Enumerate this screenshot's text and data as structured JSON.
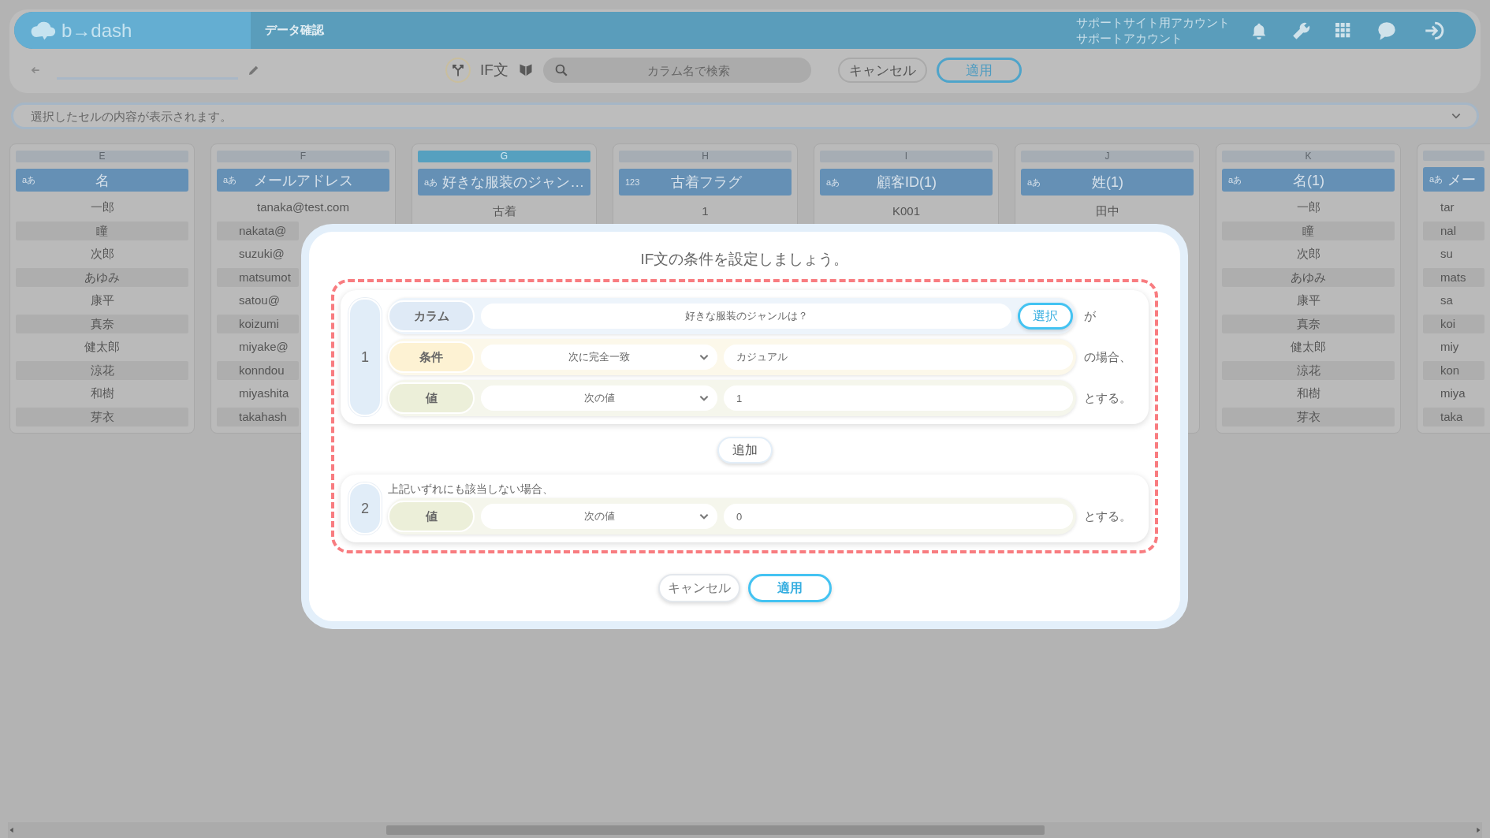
{
  "header": {
    "logo": "b→dash",
    "tabs": [
      "データ確認"
    ],
    "account_lines": [
      "サポートサイト用アカウント",
      "サポートアカウント"
    ]
  },
  "toolbar": {
    "mode_label": "IF文",
    "search": {
      "placeholder": "カラム名で検索"
    },
    "buttons": [
      {
        "label": "キャンセル",
        "kind": "secondary"
      },
      {
        "label": "適用",
        "kind": "primary"
      }
    ]
  },
  "cell_preview": {
    "placeholder": "選択したセルの内容が表示されます。"
  },
  "columns": [
    {
      "letter": "E",
      "type": "aあ",
      "title": "名",
      "selected": false,
      "cut": false,
      "cells": [
        {
          "text": "一郎",
          "cut": false
        },
        {
          "text": "瞳",
          "cut": false
        },
        {
          "text": "次郎",
          "cut": false
        },
        {
          "text": "あゆみ",
          "cut": false
        },
        {
          "text": "康平",
          "cut": false
        },
        {
          "text": "真奈",
          "cut": false
        },
        {
          "text": "健太郎",
          "cut": false
        },
        {
          "text": "涼花",
          "cut": false
        },
        {
          "text": "和樹",
          "cut": false
        },
        {
          "text": "芽衣",
          "cut": false
        }
      ]
    },
    {
      "letter": "F",
      "type": "aあ",
      "title": "メールアドレス",
      "selected": false,
      "cut": false,
      "cells": [
        {
          "text": "tanaka@test.com",
          "cut": false
        },
        {
          "text": "nakata@",
          "cut": true
        },
        {
          "text": "suzuki@",
          "cut": true
        },
        {
          "text": "matsumot",
          "cut": true
        },
        {
          "text": "satou@",
          "cut": true
        },
        {
          "text": "koizumi",
          "cut": true
        },
        {
          "text": "miyake@",
          "cut": true
        },
        {
          "text": "konndou",
          "cut": true
        },
        {
          "text": "miyashita",
          "cut": true
        },
        {
          "text": "takahash",
          "cut": true
        }
      ]
    },
    {
      "letter": "G",
      "type": "aあ",
      "title": "好きな服装のジャン…",
      "selected": true,
      "cut": false,
      "cells": [
        {
          "text": "古着",
          "cut": false
        }
      ]
    },
    {
      "letter": "H",
      "type": "123",
      "title": "古着フラグ",
      "selected": false,
      "cut": false,
      "cells": [
        {
          "text": "1",
          "cut": false
        }
      ]
    },
    {
      "letter": "I",
      "type": "aあ",
      "title": "顧客ID(1)",
      "selected": false,
      "cut": false,
      "cells": [
        {
          "text": "K001",
          "cut": false
        }
      ]
    },
    {
      "letter": "J",
      "type": "aあ",
      "title": "姓(1)",
      "selected": false,
      "cut": false,
      "cells": [
        {
          "text": "田中",
          "cut": false
        }
      ]
    },
    {
      "letter": "K",
      "type": "aあ",
      "title": "名(1)",
      "selected": false,
      "cut": false,
      "cells": [
        {
          "text": "一郎",
          "cut": false
        },
        {
          "text": "瞳",
          "cut": false
        },
        {
          "text": "次郎",
          "cut": false
        },
        {
          "text": "あゆみ",
          "cut": false
        },
        {
          "text": "康平",
          "cut": false
        },
        {
          "text": "真奈",
          "cut": false
        },
        {
          "text": "健太郎",
          "cut": false
        },
        {
          "text": "涼花",
          "cut": false
        },
        {
          "text": "和樹",
          "cut": false
        },
        {
          "text": "芽衣",
          "cut": false
        }
      ]
    },
    {
      "type": "aあ",
      "title": "メー",
      "selected": false,
      "cut": true,
      "cells": [
        {
          "text": "tar",
          "cut": true
        },
        {
          "text": "nal",
          "cut": true
        },
        {
          "text": "su",
          "cut": true
        },
        {
          "text": "mats",
          "cut": true
        },
        {
          "text": "sa",
          "cut": true
        },
        {
          "text": "koi",
          "cut": true
        },
        {
          "text": "miy",
          "cut": true
        },
        {
          "text": "kon",
          "cut": true
        },
        {
          "text": "miya",
          "cut": true
        },
        {
          "text": "taka",
          "cut": true
        }
      ]
    }
  ],
  "dialog": {
    "title": "IF文の条件を設定しましょう。",
    "conditions": [
      {
        "number": "1",
        "rows": [
          {
            "kind": "column",
            "label": "カラム",
            "value": "好きな服装のジャンルは？",
            "button": "選択",
            "suffix": "が"
          },
          {
            "kind": "condition",
            "label": "条件",
            "select": "次に完全一致",
            "value": "カジュアル",
            "suffix": "の場合、"
          },
          {
            "kind": "value",
            "label": "値",
            "select": "次の値",
            "value": "1",
            "suffix": "とする。"
          }
        ]
      }
    ],
    "add_button": "追加",
    "otherwise": {
      "number": "2",
      "caption": "上記いずれにも該当しない場合、",
      "rows": [
        {
          "kind": "value",
          "label": "値",
          "select": "次の値",
          "value": "0",
          "suffix": "とする。"
        }
      ]
    },
    "buttons": [
      {
        "label": "キャンセル",
        "kind": "secondary"
      },
      {
        "label": "適用",
        "kind": "primary"
      }
    ]
  }
}
